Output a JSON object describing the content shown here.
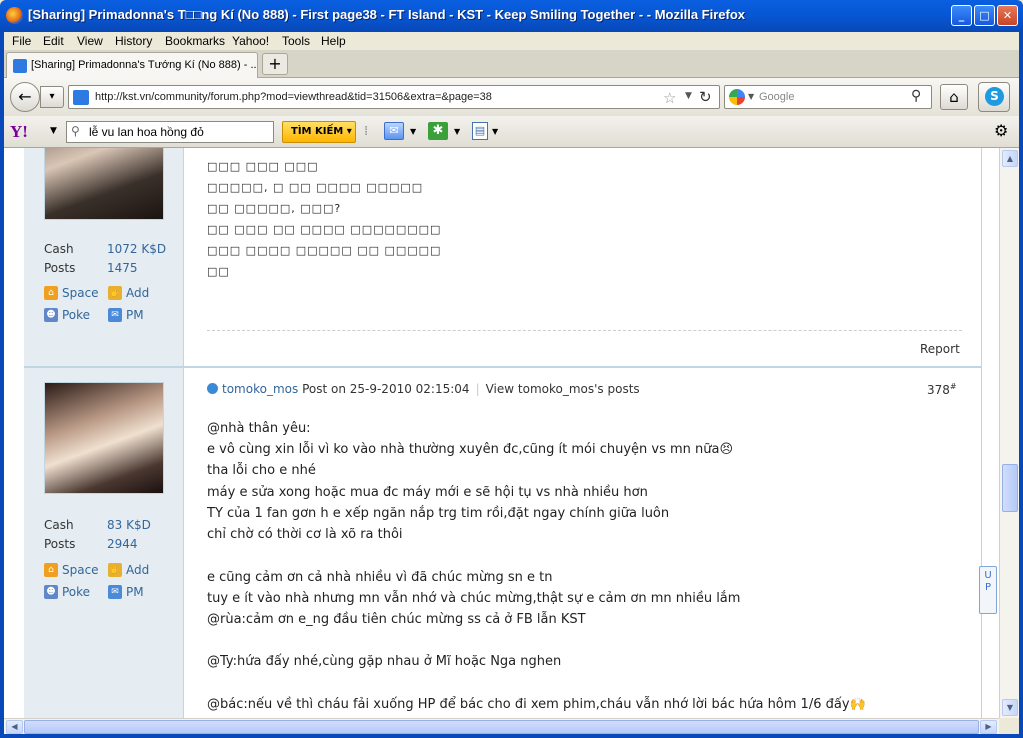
{
  "window": {
    "title": "[Sharing] Primadonna's T□□ng Kí (No 888) - First page38 - FT Island - KST - Keep Smiling Together - - Mozilla Firefox",
    "min_label": "_",
    "max_label": "□",
    "close_label": "✕"
  },
  "menu": [
    "File",
    "Edit",
    "View",
    "History",
    "Bookmarks",
    "Yahoo!",
    "Tools",
    "Help"
  ],
  "tabs": {
    "active_label": "[Sharing] Primadonna's Tướng Kí (No 888) - ...",
    "new_tab_label": "+"
  },
  "nav": {
    "back": "←",
    "forward": "▾",
    "url": "http://kst.vn/community/forum.php?mod=viewthread&tid=31506&extra=&page=38",
    "search_placeholder": "Google",
    "home": "⌂",
    "skype": "S"
  },
  "yahoo_toolbar": {
    "logo": "Y!",
    "search_value": "lễ vu lan hoa hồng đỏ",
    "search_button": "TÌM KIẾM ▾",
    "mail": "✉",
    "star": "✱",
    "notes": "▤",
    "settings": "⚙"
  },
  "post1": {
    "cash_label": "Cash",
    "cash_value": "1072 K$D",
    "posts_label": "Posts",
    "posts_value": "1475",
    "space": "Space",
    "add": "Add",
    "poke": "Poke",
    "pm": "PM",
    "lines": [
      "□□□ □□□ □□□",
      "□□□□□, □ □□ □□□□ □□□□□",
      "□□ □□□□□, □□□?",
      "□□ □□□ □□ □□□□ □□□□□□□□",
      "□□□ □□□□ □□□□□ □□ □□□□□",
      "□□"
    ],
    "report": "Report"
  },
  "post2": {
    "username": "tomoko_mos",
    "meta": "Post on 25-9-2010 02:15:04",
    "view_posts": "View tomoko_mos's posts",
    "floor": "378",
    "floor_sup": "#",
    "cash_label": "Cash",
    "cash_value": "83 K$D",
    "posts_label": "Posts",
    "posts_value": "2944",
    "space": "Space",
    "add": "Add",
    "poke": "Poke",
    "pm": "PM",
    "lines": [
      "@nhà thân yêu:",
      "e vô cùng xin lỗi vì ko vào nhà thường xuyên đc,cũng ít mói chuyện vs mn nữa😣",
      "tha lỗi cho e nhé",
      "máy e sửa xong hoặc mua đc máy mới e sẽ hội tụ vs nhà nhiều hơn",
      "TY của 1 fan gơn h e xếp ngăn nắp trg tim rồi,đặt ngay chính giữa luôn",
      "chỉ chờ có thời cơ là xõ ra thôi",
      "",
      "e cũng cảm ơn cả nhà nhiều vì đã chúc mừng sn e tn",
      "tuy e ít vào nhà nhưng mn vẫn nhớ và chúc mừng,thật sự e cảm ơn mn nhiều lắm",
      "@rùa:cảm ơn e_ng đầu tiên chúc mừng ss cả ở FB lẫn KST",
      "",
      "@Ty:hứa đấy nhé,cùng gặp nhau ở Mĩ hoặc Nga nghen",
      "",
      "@bác:nếu về thì cháu fải xuống HP để bác cho đi xem phim,cháu vẫn nhớ lời bác hứa hôm 1/6 đấy🙌"
    ]
  },
  "up_button": "U P"
}
